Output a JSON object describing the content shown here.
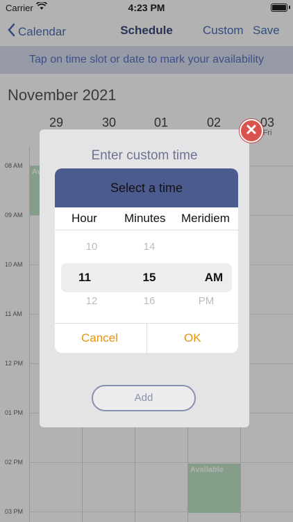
{
  "status_bar": {
    "carrier": "Carrier",
    "time": "4:23 PM"
  },
  "nav": {
    "back_label": "Calendar",
    "title": "Schedule",
    "custom_label": "Custom",
    "save_label": "Save"
  },
  "hint": "Tap on time slot or date to mark your availability",
  "calendar": {
    "month_title": "November 2021",
    "days": [
      {
        "date": "29",
        "weekday": ""
      },
      {
        "date": "30",
        "weekday": ""
      },
      {
        "date": "01",
        "weekday": ""
      },
      {
        "date": "02",
        "weekday": ""
      },
      {
        "date": "03",
        "weekday": "Fri"
      }
    ],
    "time_labels": [
      "08 AM",
      "09 AM",
      "10 AM",
      "11 AM",
      "12 PM",
      "01 PM",
      "02 PM",
      "03 PM"
    ],
    "availability": [
      {
        "label": "Av"
      },
      {
        "label": "Available"
      }
    ]
  },
  "dialog": {
    "title": "Enter custom time",
    "picker": {
      "header": "Select a time",
      "columns": [
        "Hour",
        "Minutes",
        "Meridiem"
      ],
      "hour": {
        "prev": "10",
        "selected": "11",
        "next": "12"
      },
      "minute": {
        "prev": "14",
        "selected": "15",
        "next": "16"
      },
      "meridiem": {
        "selected": "AM",
        "next": "PM"
      },
      "cancel_label": "Cancel",
      "ok_label": "OK"
    },
    "add_label": "Add"
  },
  "icons": [
    "wifi-icon",
    "battery-icon",
    "chevron-left-icon",
    "close-icon"
  ],
  "colors": {
    "accent": "#4a6fb5",
    "picker_header": "#4b5b8e",
    "action": "#e69410",
    "available": "#bfe2c5",
    "close": "#d9534f"
  }
}
